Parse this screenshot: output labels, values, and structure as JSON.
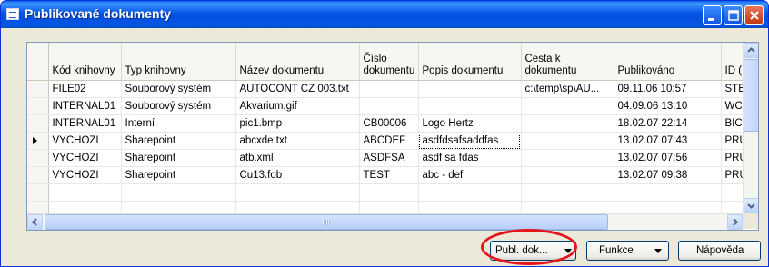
{
  "window": {
    "title": "Publikované dokumenty"
  },
  "table": {
    "headers": {
      "kod": "Kód knihovny",
      "typ": "Typ knihovny",
      "nazev": "Název dokumentu",
      "cislo": "Číslo dokumentu",
      "popis": "Popis dokumentu",
      "cesta": "Cesta k dokumentu",
      "publ": "Publikováno",
      "id": "ID ("
    },
    "rows": [
      {
        "kod": "FILE02",
        "typ": "Souborový systém",
        "nazev": "AUTOCONT CZ 003.txt",
        "cislo": "",
        "popis": "",
        "cesta": "c:\\temp\\sp\\AU...",
        "publ": "09.11.06 10:57",
        "id": "STE"
      },
      {
        "kod": "INTERNAL01",
        "typ": "Souborový systém",
        "nazev": "Akvarium.gif",
        "cislo": "",
        "popis": "",
        "cesta": "",
        "publ": "04.09.06 13:10",
        "id": "WC"
      },
      {
        "kod": "INTERNAL01",
        "typ": "Interní",
        "nazev": "pic1.bmp",
        "cislo": "CB00006",
        "popis": "Logo Hertz",
        "cesta": "",
        "publ": "18.02.07 22:14",
        "id": "BIC"
      },
      {
        "kod": "VYCHOZI",
        "typ": "Sharepoint",
        "nazev": "abcxde.txt",
        "cislo": "ABCDEF",
        "popis": "asdfdsafsaddfas",
        "cesta": "",
        "publ": "13.02.07 07:43",
        "id": "PRU"
      },
      {
        "kod": "VYCHOZI",
        "typ": "Sharepoint",
        "nazev": "atb.xml",
        "cislo": "ASDFSA",
        "popis": "asdf sa fdas",
        "cesta": "",
        "publ": "13.02.07 07:56",
        "id": "PRU"
      },
      {
        "kod": "VYCHOZI",
        "typ": "Sharepoint",
        "nazev": "Cu13.fob",
        "cislo": "TEST",
        "popis": "abc - def",
        "cesta": "",
        "publ": "13.02.07 09:38",
        "id": "PRU"
      }
    ],
    "current_row": 3
  },
  "buttons": {
    "publ_dok": "Publ. dok...",
    "funkce": "Funkce",
    "napoveda": "Nápověda"
  },
  "colors": {
    "title_bar": "#0558e6",
    "highlight_ring": "#e4151b"
  },
  "icons": [
    "window-table-icon",
    "minimize-icon",
    "maximize-icon",
    "close-icon",
    "scroll-up-icon",
    "scroll-down-icon",
    "scroll-left-icon",
    "scroll-right-icon",
    "row-pointer-icon",
    "dropdown-arrow-icon"
  ]
}
